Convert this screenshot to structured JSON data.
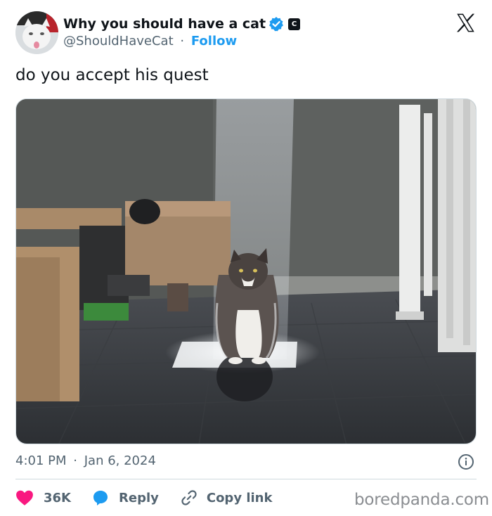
{
  "header": {
    "display_name": "Why you should have a cat",
    "handle": "@ShouldHaveCat",
    "separator": "·",
    "follow_label": "Follow",
    "affiliate_badge": "C",
    "verified_color": "#1d9bf0"
  },
  "tweet": {
    "text": "do you accept his quest",
    "time": "4:01 PM",
    "date_separator": "·",
    "date": "Jan 6, 2024"
  },
  "actions": {
    "likes_count": "36K",
    "like_color": "#f91880",
    "reply_label": "Reply",
    "reply_color": "#1d9bf0",
    "copy_label": "Copy link"
  },
  "watermark": "boredpanda.com",
  "icons": {
    "avatar": "cat-avatar",
    "verified": "verified-check-icon",
    "x_logo": "x-logo-icon",
    "info": "info-icon",
    "like": "heart-icon",
    "reply": "speech-bubble-icon",
    "copy": "link-icon"
  }
}
